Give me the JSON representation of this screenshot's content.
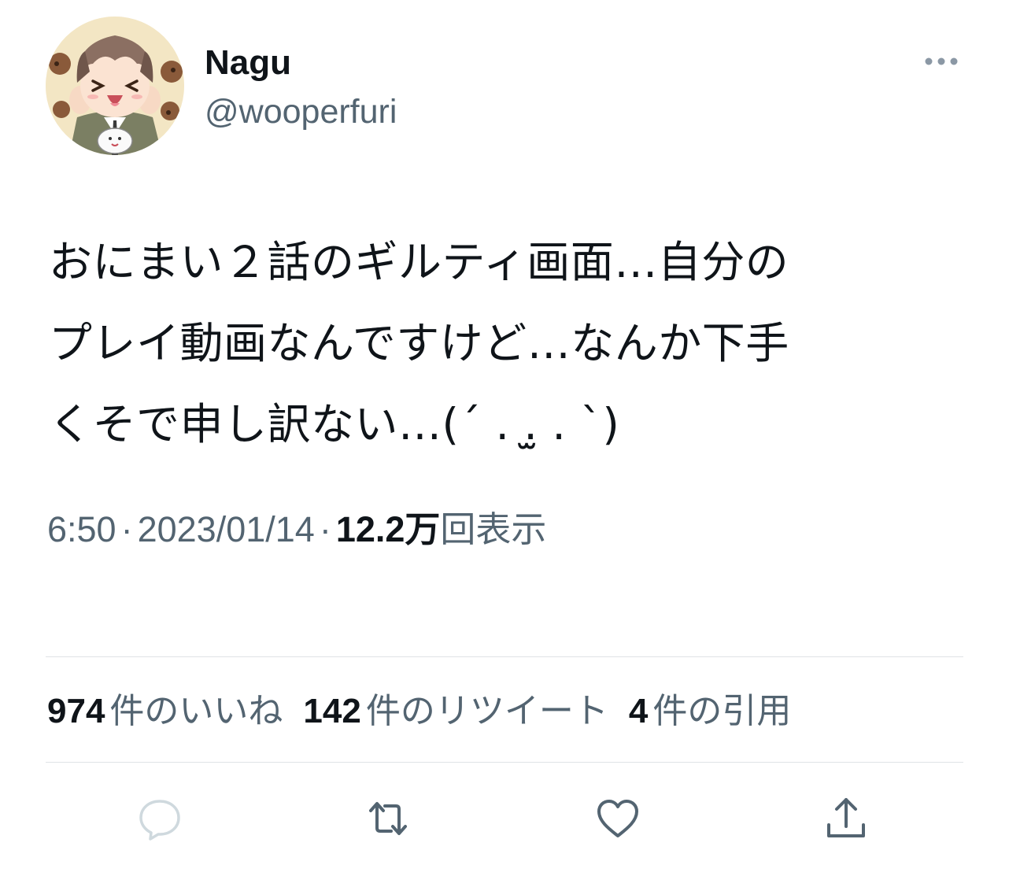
{
  "author": {
    "display_name": "Nagu",
    "handle": "@wooperfuri",
    "avatar_icon": "anime-avatar-icon"
  },
  "tweet": {
    "lines": [
      "おにまい２話のギルティ画面…自分の",
      "プレイ動画なんですけど…なんか下手",
      "くそで申し訳ない…(´ . .̫ . `)"
    ]
  },
  "meta": {
    "time": "6:50",
    "separator": "·",
    "date": "2023/01/14",
    "views_count": "12.2万",
    "views_label": "回表示"
  },
  "stats": {
    "likes_count": "974",
    "likes_label": "件のいいね",
    "retweets_count": "142",
    "retweets_label": "件のリツイート",
    "quotes_count": "4",
    "quotes_label": "件の引用"
  },
  "actions": {
    "reply_icon": "reply-icon",
    "retweet_icon": "retweet-icon",
    "like_icon": "heart-icon",
    "share_icon": "share-icon"
  },
  "colors": {
    "text_primary": "#0f1419",
    "text_secondary": "#536471",
    "divider": "#dfe3e6",
    "icon": "#536471",
    "reply_icon_disabled": "#cfd9de"
  }
}
